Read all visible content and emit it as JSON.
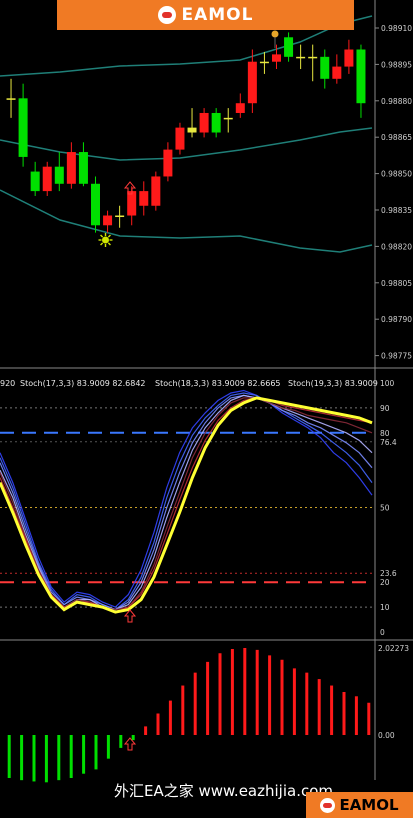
{
  "banner": {
    "brand": "EAMOL"
  },
  "price_axis": {
    "labels": [
      "0.98910",
      "0.98895",
      "0.98880",
      "0.98865",
      "0.98850",
      "0.98835",
      "0.98820",
      "0.98805",
      "0.98790",
      "0.98775"
    ]
  },
  "stoch_header": {
    "prefix": "920",
    "items": [
      "Stoch(17,3,3) 83.9009 82.6842",
      "Stoch(18,3,3) 83.9009 82.6665",
      "Stoch(19,3,3) 83.9009"
    ]
  },
  "stoch_axis": {
    "labels": [
      "100",
      "90",
      "80",
      "76.4",
      "50",
      "23.6",
      "20",
      "10",
      "0"
    ]
  },
  "hist_axis": {
    "labels": [
      "2.02273",
      "0.00"
    ]
  },
  "watermark": {
    "text": "外汇EA之家 www.eazhijia.com"
  },
  "footer_logo": {
    "brand": "EAMOL"
  },
  "colors": {
    "bull": "#00e000",
    "bear": "#ff1a1a",
    "doji": "#e8e840",
    "bands": "#1f7f78",
    "stoch_main": "#ffff33",
    "blue_dash": "#3a78ff",
    "red_dash": "#ff3a3a",
    "orange_dot": "#e6a52a"
  },
  "icons": {
    "signal_up": "up-arrow-icon",
    "sun": "sun-signal-icon",
    "dot": "orange-dot-icon"
  },
  "chart_data": [
    {
      "type": "candlestick",
      "title": "",
      "ylabel": "",
      "ylim": [
        0.9877,
        0.98915
      ],
      "candles": [
        {
          "o": 0.98878,
          "h": 0.98886,
          "l": 0.9887,
          "c": 0.98878,
          "dir": "doji"
        },
        {
          "o": 0.98878,
          "h": 0.98884,
          "l": 0.9885,
          "c": 0.98854,
          "dir": "bull"
        },
        {
          "o": 0.98848,
          "h": 0.98852,
          "l": 0.98838,
          "c": 0.9884,
          "dir": "bull"
        },
        {
          "o": 0.9884,
          "h": 0.98852,
          "l": 0.98838,
          "c": 0.9885,
          "dir": "bear"
        },
        {
          "o": 0.9885,
          "h": 0.98856,
          "l": 0.9884,
          "c": 0.98843,
          "dir": "bull"
        },
        {
          "o": 0.98843,
          "h": 0.9886,
          "l": 0.98841,
          "c": 0.98856,
          "dir": "bear"
        },
        {
          "o": 0.98856,
          "h": 0.9886,
          "l": 0.98842,
          "c": 0.98843,
          "dir": "bull"
        },
        {
          "o": 0.98843,
          "h": 0.98846,
          "l": 0.98823,
          "c": 0.98826,
          "dir": "bull"
        },
        {
          "o": 0.98826,
          "h": 0.98832,
          "l": 0.98823,
          "c": 0.9883,
          "dir": "bear"
        },
        {
          "o": 0.9883,
          "h": 0.98834,
          "l": 0.98825,
          "c": 0.9883,
          "dir": "doji"
        },
        {
          "o": 0.9883,
          "h": 0.98842,
          "l": 0.98826,
          "c": 0.9884,
          "dir": "bear"
        },
        {
          "o": 0.9884,
          "h": 0.98844,
          "l": 0.9883,
          "c": 0.98834,
          "dir": "bear"
        },
        {
          "o": 0.98834,
          "h": 0.98848,
          "l": 0.98832,
          "c": 0.98846,
          "dir": "bear"
        },
        {
          "o": 0.98846,
          "h": 0.9886,
          "l": 0.98844,
          "c": 0.98857,
          "dir": "bear"
        },
        {
          "o": 0.98857,
          "h": 0.98868,
          "l": 0.98855,
          "c": 0.98866,
          "dir": "bear"
        },
        {
          "o": 0.98866,
          "h": 0.98874,
          "l": 0.98862,
          "c": 0.98864,
          "dir": "doji"
        },
        {
          "o": 0.98864,
          "h": 0.98874,
          "l": 0.98862,
          "c": 0.98872,
          "dir": "bear"
        },
        {
          "o": 0.98872,
          "h": 0.98874,
          "l": 0.98862,
          "c": 0.98864,
          "dir": "bull"
        },
        {
          "o": 0.9887,
          "h": 0.98874,
          "l": 0.98864,
          "c": 0.9887,
          "dir": "doji"
        },
        {
          "o": 0.98872,
          "h": 0.9888,
          "l": 0.9887,
          "c": 0.98876,
          "dir": "bear"
        },
        {
          "o": 0.98876,
          "h": 0.98898,
          "l": 0.98872,
          "c": 0.98893,
          "dir": "bear"
        },
        {
          "o": 0.98893,
          "h": 0.98897,
          "l": 0.98888,
          "c": 0.98893,
          "dir": "doji"
        },
        {
          "o": 0.98893,
          "h": 0.989,
          "l": 0.9889,
          "c": 0.98896,
          "dir": "bear"
        },
        {
          "o": 0.98903,
          "h": 0.98905,
          "l": 0.98893,
          "c": 0.98895,
          "dir": "bull"
        },
        {
          "o": 0.98895,
          "h": 0.989,
          "l": 0.9889,
          "c": 0.98895,
          "dir": "doji"
        },
        {
          "o": 0.98895,
          "h": 0.989,
          "l": 0.98885,
          "c": 0.98895,
          "dir": "doji"
        },
        {
          "o": 0.98895,
          "h": 0.98898,
          "l": 0.98882,
          "c": 0.98886,
          "dir": "bull"
        },
        {
          "o": 0.98886,
          "h": 0.98896,
          "l": 0.98884,
          "c": 0.98891,
          "dir": "bear"
        },
        {
          "o": 0.98891,
          "h": 0.98902,
          "l": 0.98888,
          "c": 0.98898,
          "dir": "bear"
        },
        {
          "o": 0.98898,
          "h": 0.989,
          "l": 0.9887,
          "c": 0.98876,
          "dir": "bull"
        }
      ]
    },
    {
      "type": "line",
      "title": "",
      "ylim": [
        0,
        100
      ],
      "levels": [
        100,
        90,
        80,
        76.4,
        50,
        23.6,
        20,
        10,
        0
      ],
      "series": [
        {
          "values": [
            72,
            60,
            45,
            30,
            18,
            12,
            16,
            15,
            12,
            10,
            15,
            25,
            40,
            58,
            72,
            82,
            88,
            93,
            96,
            97,
            95,
            92,
            88,
            85,
            82,
            78,
            72,
            68,
            62,
            55
          ]
        },
        {
          "values": [
            70,
            58,
            43,
            28,
            17,
            11,
            15,
            14,
            11,
            9,
            13,
            22,
            36,
            54,
            68,
            79,
            86,
            91,
            95,
            96,
            95,
            92,
            89,
            86,
            83,
            80,
            76,
            72,
            67,
            60
          ]
        },
        {
          "values": [
            68,
            56,
            41,
            27,
            16,
            11,
            14,
            13,
            11,
            9,
            12,
            20,
            33,
            50,
            64,
            76,
            84,
            90,
            94,
            95,
            94,
            92,
            89,
            87,
            84,
            82,
            79,
            76,
            72,
            66
          ]
        },
        {
          "values": [
            65,
            54,
            39,
            26,
            15,
            10,
            13,
            13,
            10,
            9,
            11,
            18,
            30,
            46,
            60,
            73,
            82,
            88,
            93,
            95,
            94,
            92,
            90,
            88,
            86,
            84,
            82,
            80,
            77,
            72
          ]
        },
        {
          "values": [
            64,
            52,
            38,
            25,
            15,
            10,
            13,
            12,
            10,
            9,
            10,
            16,
            27,
            42,
            56,
            70,
            80,
            87,
            92,
            94,
            94,
            92,
            90,
            89,
            87,
            86,
            85,
            84,
            82,
            80
          ]
        },
        {
          "values": [
            62,
            50,
            37,
            24,
            15,
            10,
            12,
            12,
            10,
            8,
            10,
            15,
            25,
            39,
            53,
            66,
            77,
            85,
            90,
            93,
            94,
            93,
            91,
            90,
            89,
            88,
            87,
            86,
            85,
            84
          ]
        },
        {
          "values": [
            60,
            48,
            35,
            23,
            14,
            9,
            12,
            11,
            10,
            8,
            9,
            13,
            22,
            35,
            48,
            62,
            74,
            83,
            89,
            92,
            94,
            93,
            92,
            91,
            90,
            89,
            88,
            87,
            86,
            84
          ],
          "name": ""
        }
      ]
    },
    {
      "type": "bar",
      "title": "",
      "ylim": [
        -1.3,
        2.02273
      ],
      "values": [
        -1.0,
        -1.05,
        -1.08,
        -1.1,
        -1.05,
        -1.0,
        -0.9,
        -0.8,
        -0.55,
        -0.3,
        -0.12,
        0.2,
        0.5,
        0.8,
        1.15,
        1.45,
        1.7,
        1.9,
        2.0,
        2.02273,
        1.98,
        1.85,
        1.75,
        1.55,
        1.45,
        1.3,
        1.15,
        1.0,
        0.9,
        0.75
      ]
    }
  ]
}
